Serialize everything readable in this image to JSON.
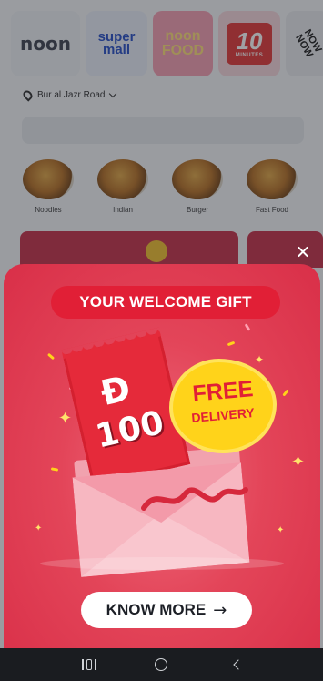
{
  "app": {
    "brands": [
      {
        "label": "noon"
      },
      {
        "label": "super\nmall"
      },
      {
        "label": "noon\nFOOD"
      },
      {
        "number": "10",
        "caption": "MINUTES"
      },
      {
        "label": "NOW\nNOW"
      }
    ],
    "location": "Bur al Jazr Road",
    "categories": [
      "Noodles",
      "Indian",
      "Burger",
      "Fast Food"
    ]
  },
  "popup": {
    "title": "YOUR WELCOME GIFT",
    "currency_symbol": "Đ",
    "amount": "100",
    "free_line1": "FREE",
    "free_line2": "DELIVERY",
    "cta_label": "KNOW MORE",
    "cta_arrow": "→",
    "close_icon": "close-icon"
  },
  "colors": {
    "sheet": "#e34559",
    "accent_red": "#e11f36",
    "badge_yellow": "#ffd31a"
  },
  "system_nav": {
    "icons": [
      "recents-icon",
      "home-icon",
      "back-icon"
    ]
  }
}
